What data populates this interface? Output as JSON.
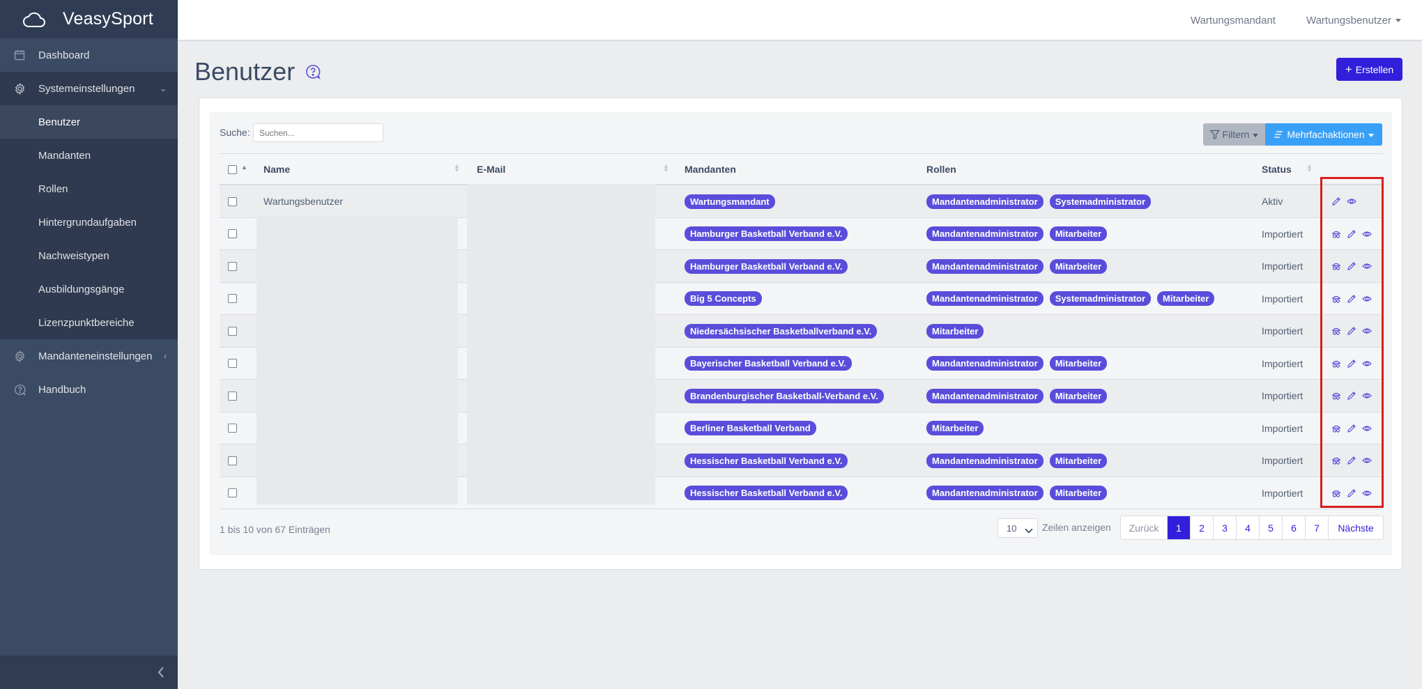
{
  "brand": {
    "name": "VeasySport",
    "icon": "cloud-icon"
  },
  "sidebar": {
    "items": [
      {
        "label": "Dashboard",
        "icon": "calendar-icon"
      },
      {
        "label": "Systemeinstellungen",
        "icon": "gear-icon"
      },
      {
        "label": "Mandanteneinstellungen",
        "icon": "gear-icon"
      },
      {
        "label": "Handbuch",
        "icon": "help-icon"
      }
    ],
    "sub_items": [
      {
        "label": "Benutzer"
      },
      {
        "label": "Mandanten"
      },
      {
        "label": "Rollen"
      },
      {
        "label": "Hintergrundaufgaben"
      },
      {
        "label": "Nachweistypen"
      },
      {
        "label": "Ausbildungsgänge"
      },
      {
        "label": "Lizenzpunktbereiche"
      }
    ]
  },
  "header": {
    "tenant": "Wartungsmandant",
    "user": "Wartungsbenutzer"
  },
  "page": {
    "title": "Benutzer",
    "create_label": "Erstellen"
  },
  "toolbar": {
    "search_label": "Suche:",
    "search_placeholder": "Suchen...",
    "filter_label": "Filtern",
    "multi_label": "Mehrfachaktionen"
  },
  "table": {
    "columns": {
      "name": "Name",
      "email": "E-Mail",
      "tenants": "Mandanten",
      "roles": "Rollen",
      "status": "Status"
    },
    "rows": [
      {
        "name": "Wartungsbenutzer",
        "tenants": [
          "Wartungsmandant"
        ],
        "roles": [
          "Mandantenadministrator",
          "Systemadministrator"
        ],
        "status": "Aktiv"
      },
      {
        "name": "",
        "tenants": [
          "Hamburger Basketball Verband e.V."
        ],
        "roles": [
          "Mandantenadministrator",
          "Mitarbeiter"
        ],
        "status": "Importiert"
      },
      {
        "name": "",
        "tenants": [
          "Hamburger Basketball Verband e.V."
        ],
        "roles": [
          "Mandantenadministrator",
          "Mitarbeiter"
        ],
        "status": "Importiert"
      },
      {
        "name": "",
        "tenants": [
          "Big 5 Concepts"
        ],
        "roles": [
          "Mandantenadministrator",
          "Systemadministrator",
          "Mitarbeiter"
        ],
        "status": "Importiert"
      },
      {
        "name": "",
        "tenants": [
          "Niedersächsischer Basketballverband e.V."
        ],
        "roles": [
          "Mitarbeiter"
        ],
        "status": "Importiert"
      },
      {
        "name": "",
        "tenants": [
          "Bayerischer Basketball Verband e.V."
        ],
        "roles": [
          "Mandantenadministrator",
          "Mitarbeiter"
        ],
        "status": "Importiert"
      },
      {
        "name": "",
        "tenants": [
          "Brandenburgischer Basketball-Verband e.V."
        ],
        "roles": [
          "Mandantenadministrator",
          "Mitarbeiter"
        ],
        "status": "Importiert"
      },
      {
        "name": "",
        "tenants": [
          "Berliner Basketball Verband"
        ],
        "roles": [
          "Mitarbeiter"
        ],
        "status": "Importiert"
      },
      {
        "name": "",
        "tenants": [
          "Hessischer Basketball Verband e.V."
        ],
        "roles": [
          "Mandantenadministrator",
          "Mitarbeiter"
        ],
        "status": "Importiert"
      },
      {
        "name": "",
        "tenants": [
          "Hessischer Basketball Verband e.V."
        ],
        "roles": [
          "Mandantenadministrator",
          "Mitarbeiter"
        ],
        "status": "Importiert"
      }
    ]
  },
  "footer": {
    "entries_text": "1 bis 10 von 67 Einträgen",
    "rows_value": "10",
    "rows_label": "Zeilen anzeigen",
    "prev_label": "Zurück",
    "next_label": "Nächste",
    "pages": [
      "1",
      "2",
      "3",
      "4",
      "5",
      "6",
      "7"
    ],
    "current_page": "1"
  },
  "colors": {
    "primary": "#321fdb",
    "info": "#39a0f7",
    "sidebar": "#3c4b64",
    "badge": "#5a4ddb",
    "highlight": "#d91e1e"
  }
}
